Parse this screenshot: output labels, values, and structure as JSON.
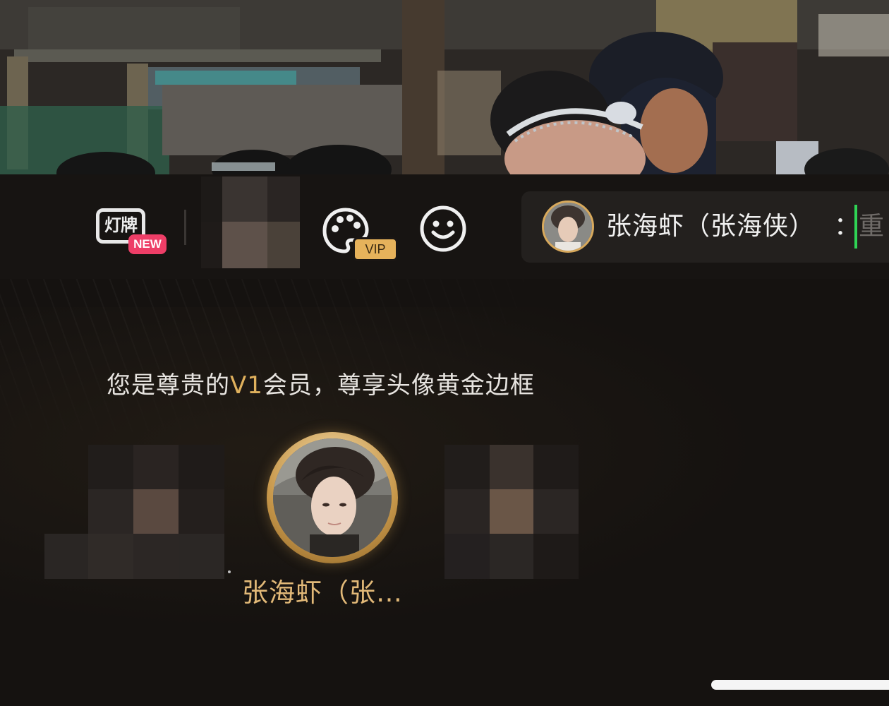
{
  "toolbar": {
    "lamp_label": "灯牌",
    "lamp_badge": "NEW",
    "palette_badge": "VIP",
    "icons": [
      "lamp-sign-icon",
      "palette-icon",
      "smile-icon"
    ]
  },
  "comment_bar": {
    "username": "张海虾（张海侠）",
    "colon": "：",
    "placeholder": "重"
  },
  "frame_panel": {
    "member_prefix": "您是尊贵的",
    "member_level": "V1",
    "member_suffix": "会员，尊享头像黄金边框",
    "selected_name": "张海虾（张…"
  },
  "colors": {
    "accent_gold": "#e0b15d",
    "badge_new": "#ee3e67",
    "cursor_green": "#2fd455",
    "background": "#151210"
  }
}
